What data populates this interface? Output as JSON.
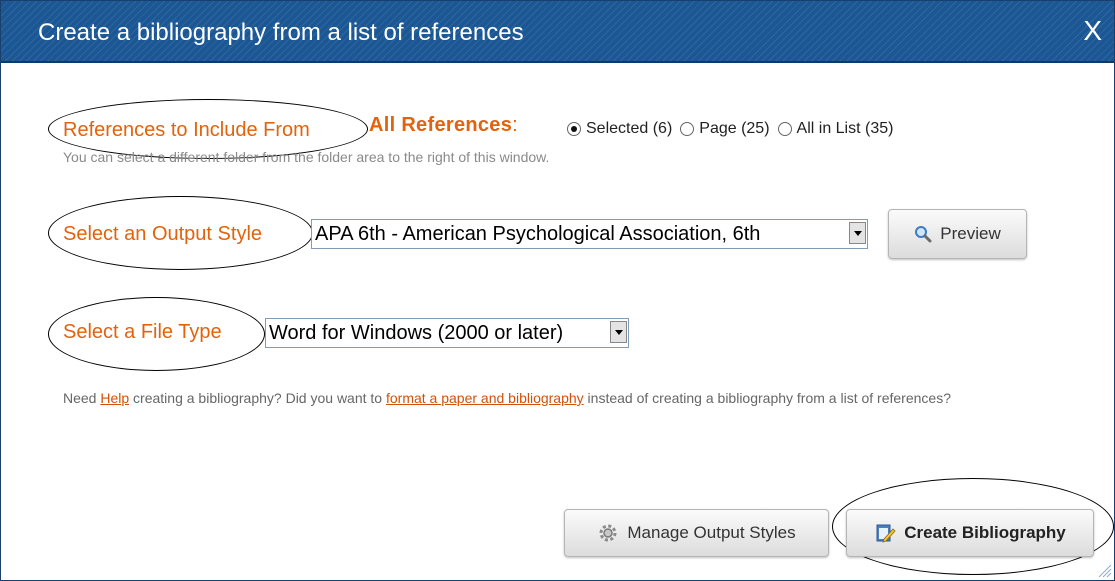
{
  "dialog": {
    "title": "Create a bibliography from a list of references",
    "close_label": "X"
  },
  "references": {
    "label": "References to Include From",
    "source": "All References",
    "source_suffix": ":",
    "options": [
      {
        "label": "Selected (6)",
        "checked": true
      },
      {
        "label": "Page (25)",
        "checked": false
      },
      {
        "label": "All in List (35)",
        "checked": false
      }
    ],
    "hint": "You can select a different folder from the folder area to the right of this window."
  },
  "output_style": {
    "label": "Select an Output Style",
    "selected": "APA 6th - American Psychological Association, 6th",
    "preview_button": "Preview"
  },
  "file_type": {
    "label": "Select a File Type",
    "selected": "Word for Windows (2000 or later)"
  },
  "help_text": {
    "part1": "Need ",
    "help_link": "Help",
    "part2": " creating a bibliography? Did you want to ",
    "format_link": "format a paper and bibliography",
    "part3": " instead of creating a bibliography from a list of references?"
  },
  "actions": {
    "manage_styles": "Manage Output Styles",
    "create": "Create Bibliography"
  },
  "colors": {
    "titlebar": "#1b5794",
    "accent": "#e3620c",
    "link": "#d2510a"
  },
  "icons": {
    "preview": "magnifier-icon",
    "manage": "gear-icon",
    "create": "notepad-pencil-icon",
    "close": "close-icon"
  }
}
